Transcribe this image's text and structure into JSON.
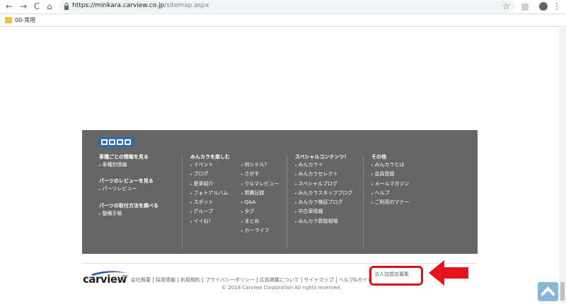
{
  "browser": {
    "back_icon": "←",
    "forward_icon": "→",
    "reload_icon": "C",
    "home_icon": "⌂",
    "url_host": "https://minkara.carview.co.jp",
    "url_path": "/sitemap.aspx",
    "star_icon": "☆",
    "menu_icon": "⋮",
    "bookmark_label": "00-常用"
  },
  "footer": {
    "col1": {
      "heading1": "車種ごとの情報を見る",
      "items1": [
        "車種別情報"
      ],
      "heading2": "パーツのレビューを見る",
      "items2": [
        "パーツレビュー"
      ],
      "heading3": "パーツの取付方法を調べる",
      "items3": [
        "整備手帳"
      ]
    },
    "col2": {
      "heading": "みんカラを楽しむ",
      "items_a": [
        "イベント",
        "ブログ",
        "愛車紹介",
        "フォトアルバム",
        "スポット",
        "グループ",
        "イイね！"
      ],
      "items_b": [
        "何シテル？",
        "さがす",
        "クルマレビュー",
        "燃費記録",
        "Q&A",
        "タグ",
        "まとめ",
        "カーライフ"
      ]
    },
    "col3": {
      "heading": "スペシャルコンテンツ！",
      "items": [
        "みんカラ＋",
        "みんカラセレクト",
        "スペシャルブログ",
        "みんカラスタッフブログ",
        "みんカラ検証ブログ",
        "中古車情報",
        "みんカラ買取相場"
      ]
    },
    "col4": {
      "heading": "その他",
      "items": [
        "みんカラとは",
        "会員登録",
        "メールマガジン",
        "ヘルプ",
        "ご利用のマナー"
      ]
    }
  },
  "bottom": {
    "logo_text": "carview",
    "logo_tm": "TM",
    "links": [
      "会社概要",
      "採用情報",
      "利用規約",
      "プライバシーポリシー",
      "広告掲載について",
      "サイトマップ",
      "ヘルプ&ガイド"
    ],
    "corp_link": "法人加盟店募集",
    "copyright": "© 2018 Carview Corporation All rights reserved.",
    "highlight_color": "#dd1111",
    "top_button_icon": "chevron-up-icon"
  }
}
